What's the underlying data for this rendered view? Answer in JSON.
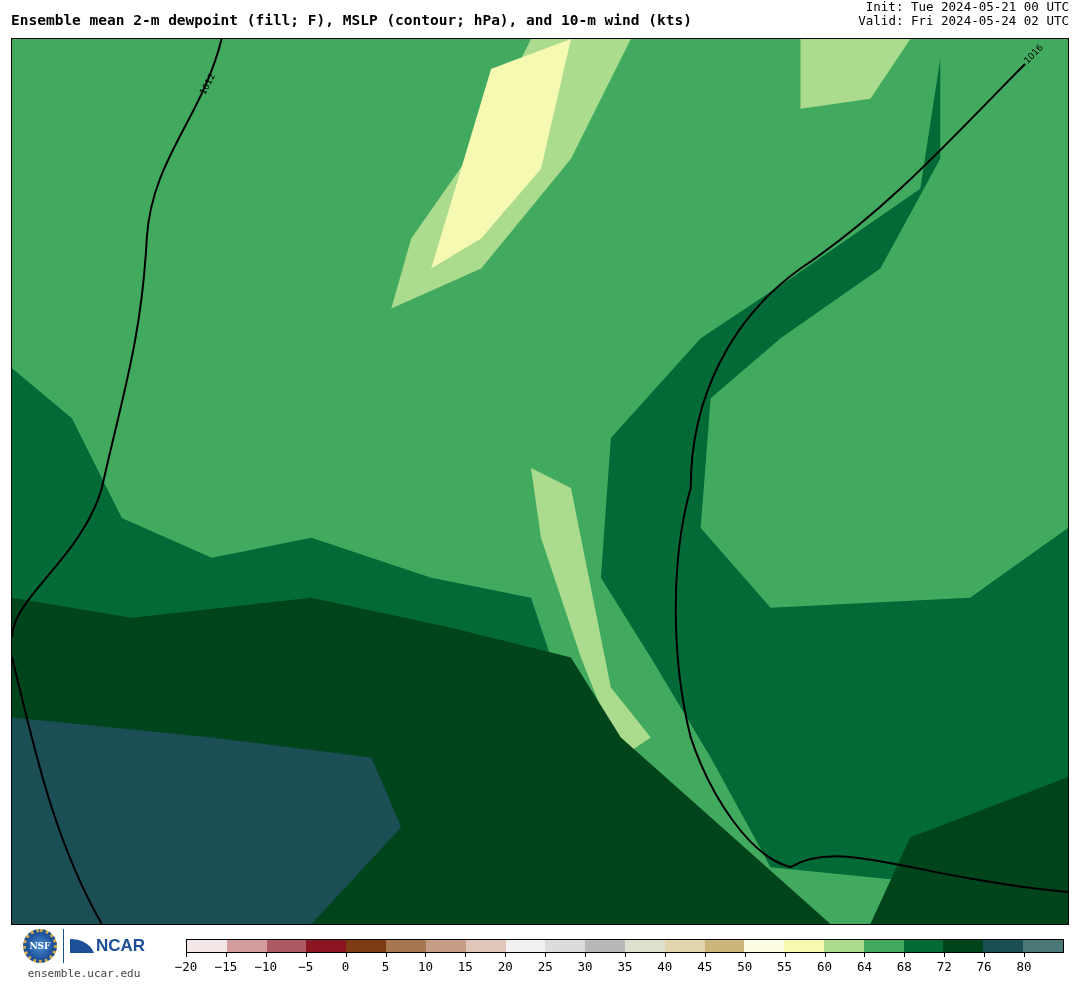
{
  "title": "Ensemble mean 2-m dewpoint (fill; F), MSLP (contour; hPa), and 10-m wind (kts)",
  "init": "Init: Tue 2024-05-21 00 UTC",
  "valid": "Valid: Fri 2024-05-24 02 UTC",
  "map": {
    "contour_labels": [
      "1012",
      "1016"
    ]
  },
  "logo": {
    "nsf": "NSF",
    "ncar": "NCAR",
    "url": "ensemble.ucar.edu"
  },
  "colorbar": [
    {
      "label": "−20",
      "color": "#f3e6e6"
    },
    {
      "label": "−15",
      "color": "#d39c9f"
    },
    {
      "label": "−10",
      "color": "#ad5b62"
    },
    {
      "label": "−5",
      "color": "#8b1520"
    },
    {
      "label": "0",
      "color": "#7f3b12"
    },
    {
      "label": "5",
      "color": "#a97652"
    },
    {
      "label": "10",
      "color": "#c69e86"
    },
    {
      "label": "15",
      "color": "#e0c6b8"
    },
    {
      "label": "20",
      "color": "#f0f1f0"
    },
    {
      "label": "25",
      "color": "#dcdcdc"
    },
    {
      "label": "30",
      "color": "#b8b8b8"
    },
    {
      "label": "35",
      "color": "#dfdfd0"
    },
    {
      "label": "40",
      "color": "#e2d5ae"
    },
    {
      "label": "45",
      "color": "#ccb67c"
    },
    {
      "label": "50",
      "color": "#fdfde4"
    },
    {
      "label": "55",
      "color": "#f6f9b2"
    },
    {
      "label": "60",
      "color": "#abdc8e"
    },
    {
      "label": "64",
      "color": "#42aa5f"
    },
    {
      "label": "68",
      "color": "#016a37"
    },
    {
      "label": "72",
      "color": "#00441c"
    },
    {
      "label": "76",
      "color": "#1b4e55"
    },
    {
      "label": "80",
      "color": "#4d7878"
    }
  ]
}
